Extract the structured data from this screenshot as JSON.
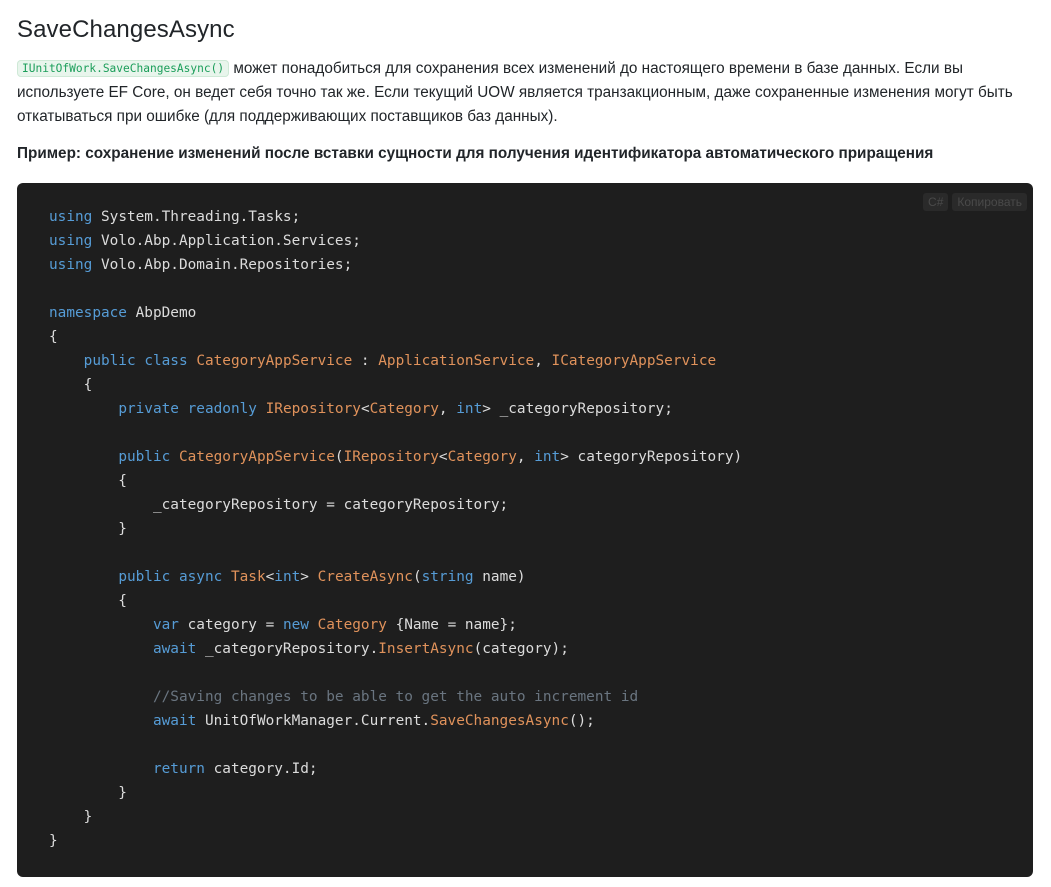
{
  "section": {
    "title": "SaveChangesAsync",
    "inline_code": "IUnitOfWork.SaveChangesAsync()",
    "description_rest": " может понадобиться для сохранения всех изменений до настоящего времени в базе данных. Если вы используете EF Core, он ведет себя точно так же. Если текущий UOW является транзакционным, даже сохраненные изменения могут быть откатываться при ошибке (для поддерживающих поставщиков баз данных).",
    "example_heading": "Пример: сохранение изменений после вставки сущности для получения идентификатора автоматического приращения"
  },
  "code_block": {
    "language_label": "C#",
    "copy_label": "Копировать",
    "lines": [
      [
        [
          "kw",
          "using"
        ],
        [
          "pl",
          " System.Threading.Tasks;"
        ]
      ],
      [
        [
          "kw",
          "using"
        ],
        [
          "pl",
          " Volo.Abp.Application.Services;"
        ]
      ],
      [
        [
          "kw",
          "using"
        ],
        [
          "pl",
          " Volo.Abp.Domain.Repositories;"
        ]
      ],
      [],
      [
        [
          "kw",
          "namespace"
        ],
        [
          "pl",
          " AbpDemo"
        ]
      ],
      [
        [
          "pl",
          "{"
        ]
      ],
      [
        [
          "pl",
          "    "
        ],
        [
          "kw",
          "public"
        ],
        [
          "pl",
          " "
        ],
        [
          "kw",
          "class"
        ],
        [
          "pl",
          " "
        ],
        [
          "ty",
          "CategoryAppService"
        ],
        [
          "pl",
          " : "
        ],
        [
          "ty",
          "ApplicationService"
        ],
        [
          "pl",
          ", "
        ],
        [
          "ty",
          "ICategoryAppService"
        ]
      ],
      [
        [
          "pl",
          "    {"
        ]
      ],
      [
        [
          "pl",
          "        "
        ],
        [
          "kw",
          "private"
        ],
        [
          "pl",
          " "
        ],
        [
          "kw",
          "readonly"
        ],
        [
          "pl",
          " "
        ],
        [
          "ty",
          "IRepository"
        ],
        [
          "pl",
          "<"
        ],
        [
          "ty",
          "Category"
        ],
        [
          "pl",
          ", "
        ],
        [
          "kw",
          "int"
        ],
        [
          "pl",
          "> _categoryRepository;"
        ]
      ],
      [],
      [
        [
          "pl",
          "        "
        ],
        [
          "kw",
          "public"
        ],
        [
          "pl",
          " "
        ],
        [
          "fn",
          "CategoryAppService"
        ],
        [
          "pl",
          "("
        ],
        [
          "ty",
          "IRepository"
        ],
        [
          "pl",
          "<"
        ],
        [
          "ty",
          "Category"
        ],
        [
          "pl",
          ", "
        ],
        [
          "kw",
          "int"
        ],
        [
          "pl",
          "> categoryRepository)"
        ]
      ],
      [
        [
          "pl",
          "        {"
        ]
      ],
      [
        [
          "pl",
          "            _categoryRepository = categoryRepository;"
        ]
      ],
      [
        [
          "pl",
          "        }"
        ]
      ],
      [],
      [
        [
          "pl",
          "        "
        ],
        [
          "kw",
          "public"
        ],
        [
          "pl",
          " "
        ],
        [
          "kw",
          "async"
        ],
        [
          "pl",
          " "
        ],
        [
          "ty",
          "Task"
        ],
        [
          "pl",
          "<"
        ],
        [
          "kw",
          "int"
        ],
        [
          "pl",
          "> "
        ],
        [
          "fn",
          "CreateAsync"
        ],
        [
          "pl",
          "("
        ],
        [
          "kw",
          "string"
        ],
        [
          "pl",
          " name)"
        ]
      ],
      [
        [
          "pl",
          "        {"
        ]
      ],
      [
        [
          "pl",
          "            "
        ],
        [
          "kw",
          "var"
        ],
        [
          "pl",
          " category = "
        ],
        [
          "kw",
          "new"
        ],
        [
          "pl",
          " "
        ],
        [
          "ty",
          "Category"
        ],
        [
          "pl",
          " {Name = name};"
        ]
      ],
      [
        [
          "pl",
          "            "
        ],
        [
          "kw",
          "await"
        ],
        [
          "pl",
          " _categoryRepository."
        ],
        [
          "fn",
          "InsertAsync"
        ],
        [
          "pl",
          "(category);"
        ]
      ],
      [],
      [
        [
          "pl",
          "            "
        ],
        [
          "cm",
          "//Saving changes to be able to get the auto increment id"
        ]
      ],
      [
        [
          "pl",
          "            "
        ],
        [
          "kw",
          "await"
        ],
        [
          "pl",
          " UnitOfWorkManager.Current."
        ],
        [
          "fn",
          "SaveChangesAsync"
        ],
        [
          "pl",
          "();"
        ]
      ],
      [],
      [
        [
          "pl",
          "            "
        ],
        [
          "kw",
          "return"
        ],
        [
          "pl",
          " category.Id;"
        ]
      ],
      [
        [
          "pl",
          "        }"
        ]
      ],
      [
        [
          "pl",
          "    }"
        ]
      ],
      [
        [
          "pl",
          "}"
        ]
      ]
    ]
  },
  "colors": {
    "keyword": "#569cd6",
    "type": "#e0925b",
    "comment": "#6a7580",
    "plain": "#dcdcdc",
    "code_background": "#1e1e1e",
    "inline_code": "#1b9e5a"
  }
}
